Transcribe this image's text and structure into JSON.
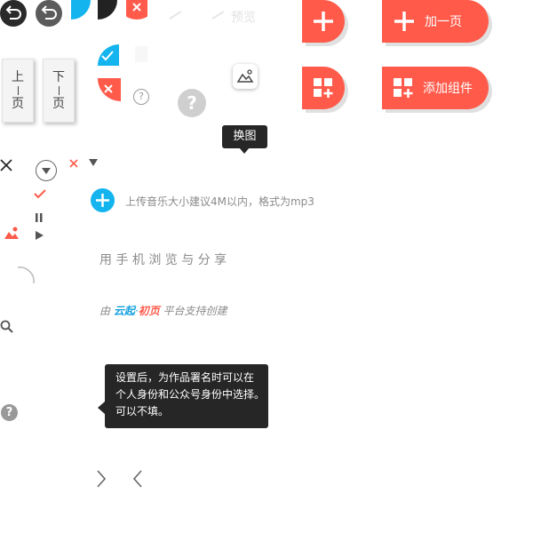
{
  "top_controls": {
    "preview_label": "预览"
  },
  "page_buttons": {
    "prev": [
      "上",
      "页"
    ],
    "next": [
      "下",
      "页"
    ]
  },
  "pill_buttons": {
    "add_page_label": "加一页",
    "add_component_label": "添加组件"
  },
  "tooltip_swap": {
    "label": "换图"
  },
  "upload_hint": "上传音乐大小建议4M以内，格式为mp3",
  "share_text": "用 手 机 浏 览 与 分 享",
  "powered_by": {
    "prefix": "由",
    "brand_a": "云起",
    "dot": "·",
    "brand_b": "初页",
    "suffix": "平台支持创建"
  },
  "info_tooltip": {
    "lines": [
      "设置后，为作品署名时可以在",
      "个人身份和公众号身份中选择。",
      "可以不填。"
    ]
  },
  "colors": {
    "accent": "#ff5a4a",
    "blue": "#14b4ee",
    "dark": "#262626"
  },
  "icons": {
    "question": "?",
    "play": "▶",
    "pause": "❚❚",
    "check": "✓",
    "close": "✕",
    "chevron_right": "›",
    "chevron_left": "‹"
  }
}
